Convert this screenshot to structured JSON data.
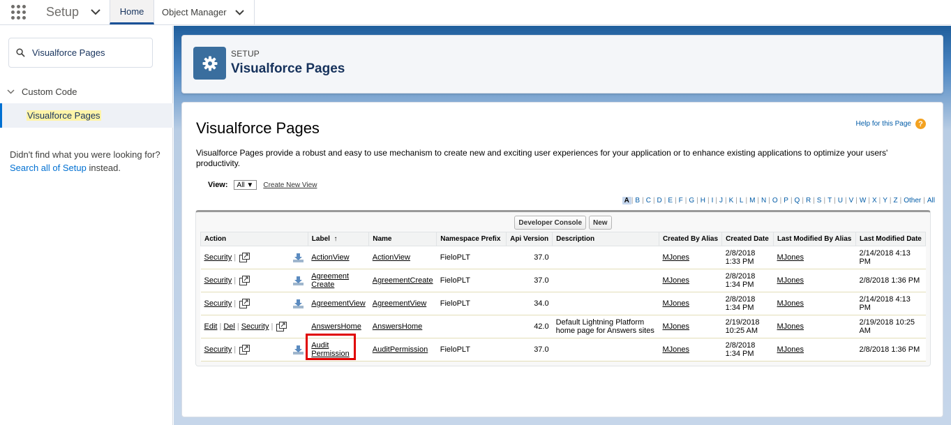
{
  "topbar": {
    "app_name": "Setup",
    "tabs": [
      {
        "label": "Home",
        "active": true
      },
      {
        "label": "Object Manager",
        "active": false
      }
    ]
  },
  "sidebar": {
    "quickfind_value": "Visualforce Pages",
    "tree_node": "Custom Code",
    "tree_leaf": "Visualforce Pages",
    "notfound_before": "Didn't find what you were looking for? ",
    "notfound_link": "Search all of Setup",
    "notfound_after": " instead."
  },
  "header": {
    "eyebrow": "SETUP",
    "title": "Visualforce Pages",
    "icon": "gear-icon"
  },
  "content": {
    "title": "Visualforce Pages",
    "help_label": "Help for this Page",
    "description": "Visualforce Pages provide a robust and easy to use mechanism to create new and exciting user experiences for your application or to enhance existing applications to optimize your users' productivity.",
    "view_label": "View:",
    "view_value": "All",
    "create_view": "Create New View",
    "alphabet": [
      "A",
      "B",
      "C",
      "D",
      "E",
      "F",
      "G",
      "H",
      "I",
      "J",
      "K",
      "L",
      "M",
      "N",
      "O",
      "P",
      "Q",
      "R",
      "S",
      "T",
      "U",
      "V",
      "W",
      "X",
      "Y",
      "Z",
      "Other",
      "All"
    ],
    "alphabet_selected": "A",
    "buttons": {
      "developer_console": "Developer Console",
      "new": "New"
    }
  },
  "table": {
    "columns": [
      "Action",
      "Label",
      "Name",
      "Namespace Prefix",
      "Api Version",
      "Description",
      "Created By Alias",
      "Created Date",
      "Last Modified By Alias",
      "Last Modified Date"
    ],
    "sort_indicator": "↑",
    "action_labels": {
      "security": "Security",
      "edit": "Edit",
      "del": "Del"
    },
    "rows": [
      {
        "label": "ActionView",
        "name": "ActionView",
        "ns": "FieloPLT",
        "api": "37.0",
        "desc": "",
        "created_by": "MJones",
        "created_date": "2/8/2018 1:33 PM",
        "modified_by": "MJones",
        "modified_date": "2/14/2018 4:13 PM",
        "editable": false
      },
      {
        "label": "Agreement Create",
        "name": "AgreementCreate",
        "ns": "FieloPLT",
        "api": "37.0",
        "desc": "",
        "created_by": "MJones",
        "created_date": "2/8/2018 1:34 PM",
        "modified_by": "MJones",
        "modified_date": "2/8/2018 1:36 PM",
        "editable": false
      },
      {
        "label": "AgreementView",
        "name": "AgreementView",
        "ns": "FieloPLT",
        "api": "34.0",
        "desc": "",
        "created_by": "MJones",
        "created_date": "2/8/2018 1:34 PM",
        "modified_by": "MJones",
        "modified_date": "2/14/2018 4:13 PM",
        "editable": false
      },
      {
        "label": "AnswersHome",
        "name": "AnswersHome",
        "ns": "",
        "api": "42.0",
        "desc": "Default Lightning Platform home page for Answers sites",
        "created_by": "MJones",
        "created_date": "2/19/2018 10:25 AM",
        "modified_by": "MJones",
        "modified_date": "2/19/2018 10:25 AM",
        "editable": true
      },
      {
        "label": "Audit Permission",
        "name": "AuditPermission",
        "ns": "FieloPLT",
        "api": "37.0",
        "desc": "",
        "created_by": "MJones",
        "created_date": "2/8/2018 1:34 PM",
        "modified_by": "MJones",
        "modified_date": "2/8/2018 1:36 PM",
        "editable": false
      }
    ]
  },
  "colors": {
    "brand": "#0070d2",
    "link": "#015ba7",
    "highlight": "#e00000"
  }
}
